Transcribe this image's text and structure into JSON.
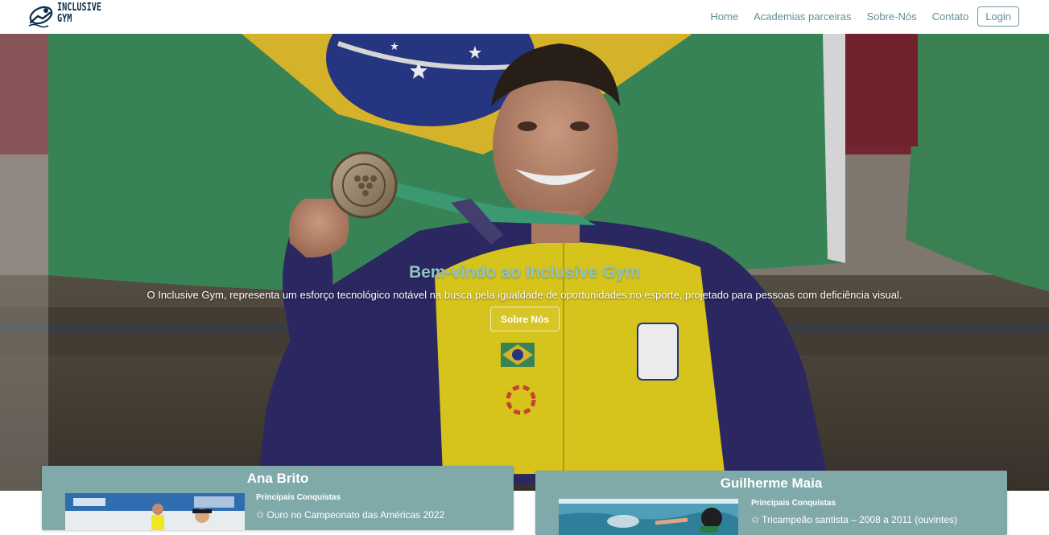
{
  "brand": {
    "logo_lines": [
      "INCLUSIVE",
      "GYM"
    ],
    "icon": "swimmer-logo-icon"
  },
  "nav": {
    "links": [
      {
        "label": "Home"
      },
      {
        "label": "Academias parceiras"
      },
      {
        "label": "Sobre-Nós"
      },
      {
        "label": "Contato"
      }
    ],
    "login_label": "Login"
  },
  "hero": {
    "title": "Bem-vindo ao Inclusive Gym",
    "subtitle": "O Inclusive Gym, representa um esforço tecnológico notável na busca pela igualdade de oportunidades no esporte, projetado para pessoas com deficiência visual.",
    "button_label": "Sobre Nós"
  },
  "cards": [
    {
      "name": "Ana Brito",
      "section_title": "Principais Conquistas",
      "first_item": "✩ Ouro no Campeonato das Américas 2022"
    },
    {
      "name": "Guilherme Maia",
      "section_title": "Principais Conquistas",
      "first_item": "✩ Tricampeão santista – 2008 a 2011 (ouvintes)"
    }
  ],
  "colors": {
    "nav_link": "#5f8f96",
    "hero_title": "#8fc3c4",
    "card_bg": "#80aaaa",
    "brand_dark": "#0f2c46"
  }
}
